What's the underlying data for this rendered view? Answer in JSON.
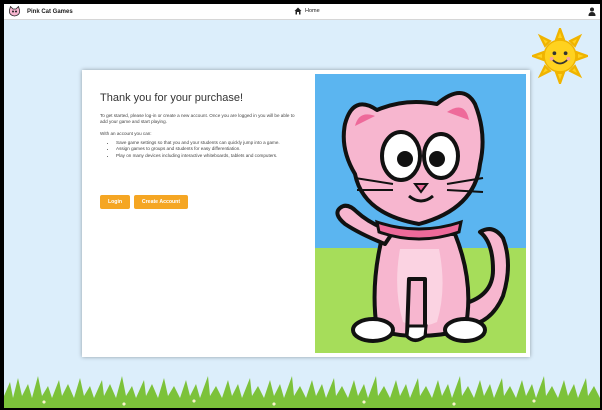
{
  "header": {
    "brand_name": "Pink Cat Games",
    "home_label": "Home"
  },
  "card": {
    "title": "Thank you for your purchase!",
    "intro": "To get started, please log-in or create a new account. Once you are logged in you will be able to add your game and start playing.",
    "with_account": "With an account you can:",
    "benefits": [
      "Save game settings so that you and your students can quickly jump into a game.",
      "Assign games to groups and students for easy differentiation.",
      "Play on many devices including interactive whiteboards, tablets and computers."
    ],
    "login_label": "Login",
    "create_label": "Create Account"
  },
  "icons": {
    "brand": "pink-cat-logo-icon",
    "home": "home-icon",
    "user": "user-icon",
    "sun": "smiling-sun-icon"
  },
  "colors": {
    "accent": "#f5a623",
    "page_background": "#dceefb",
    "cat_pink": "#f7b6cf",
    "sky": "#5bb5f0",
    "grass": "#a6dd5a"
  }
}
